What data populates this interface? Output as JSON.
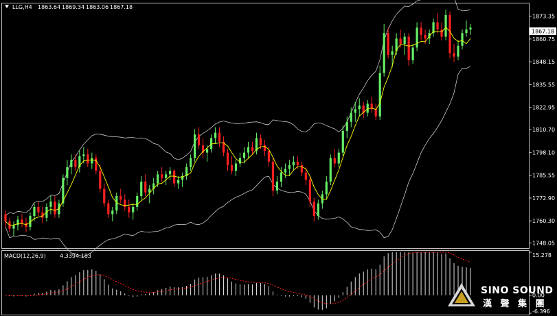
{
  "header": {
    "symbol_label": "LLG,H4",
    "open": "1863.64",
    "high": "1869.34",
    "low": "1863.06",
    "close": "1867.18"
  },
  "price_axis": {
    "ticks": [
      "1873.35",
      "1860.75",
      "1848.15",
      "1835.55",
      "1822.95",
      "1810.70",
      "1798.10",
      "1785.55",
      "1772.90",
      "1760.30",
      "1748.05"
    ],
    "current_price": "1867.18"
  },
  "macd": {
    "label": "MACD(12,26,9)",
    "macd_value": "4.339",
    "signal_value": "4.183",
    "ticks": [
      "15.278",
      "0.00",
      "-6.396"
    ]
  },
  "watermark": {
    "brand_en": "SINO SOUND",
    "brand_cn": "漢 聲 集 團"
  },
  "colors": {
    "background": "#000000",
    "bull": "#66ee66",
    "bear": "#ff2020",
    "ma": "#ffff00",
    "bollinger": "#c8c8c8",
    "macd_hist": "#e0e0e0",
    "macd_signal": "#ff2020",
    "panel_border": "#c0c0c0"
  },
  "chart_data": {
    "type": "candlestick",
    "title": "LLG,H4",
    "ylim": [
      1746,
      1880
    ],
    "ohlc": [
      [
        1764,
        1766,
        1757,
        1760
      ],
      [
        1760,
        1762,
        1754,
        1756
      ],
      [
        1756,
        1760,
        1752,
        1758
      ],
      [
        1758,
        1763,
        1755,
        1761
      ],
      [
        1761,
        1764,
        1757,
        1759
      ],
      [
        1759,
        1762,
        1754,
        1757
      ],
      [
        1757,
        1765,
        1755,
        1763
      ],
      [
        1763,
        1770,
        1760,
        1768
      ],
      [
        1768,
        1771,
        1763,
        1765
      ],
      [
        1765,
        1768,
        1759,
        1762
      ],
      [
        1762,
        1770,
        1760,
        1768
      ],
      [
        1768,
        1774,
        1764,
        1771
      ],
      [
        1771,
        1774,
        1762,
        1764
      ],
      [
        1764,
        1772,
        1762,
        1770
      ],
      [
        1770,
        1786,
        1768,
        1784
      ],
      [
        1784,
        1794,
        1780,
        1790
      ],
      [
        1790,
        1797,
        1786,
        1794
      ],
      [
        1794,
        1797,
        1788,
        1790
      ],
      [
        1790,
        1799,
        1787,
        1796
      ],
      [
        1796,
        1801,
        1792,
        1797
      ],
      [
        1797,
        1800,
        1790,
        1792
      ],
      [
        1792,
        1798,
        1789,
        1795
      ],
      [
        1795,
        1797,
        1786,
        1788
      ],
      [
        1788,
        1791,
        1776,
        1778
      ],
      [
        1778,
        1781,
        1768,
        1770
      ],
      [
        1770,
        1772,
        1762,
        1764
      ],
      [
        1764,
        1768,
        1760,
        1766
      ],
      [
        1766,
        1776,
        1764,
        1774
      ],
      [
        1774,
        1778,
        1770,
        1772
      ],
      [
        1772,
        1775,
        1766,
        1768
      ],
      [
        1768,
        1772,
        1762,
        1765
      ],
      [
        1765,
        1770,
        1761,
        1768
      ],
      [
        1768,
        1776,
        1766,
        1774
      ],
      [
        1774,
        1785,
        1772,
        1782
      ],
      [
        1782,
        1786,
        1774,
        1776
      ],
      [
        1776,
        1780,
        1770,
        1778
      ],
      [
        1778,
        1784,
        1775,
        1781
      ],
      [
        1781,
        1788,
        1779,
        1786
      ],
      [
        1786,
        1790,
        1782,
        1784
      ],
      [
        1784,
        1788,
        1780,
        1786
      ],
      [
        1786,
        1790,
        1783,
        1788
      ],
      [
        1788,
        1789,
        1779,
        1781
      ],
      [
        1781,
        1785,
        1778,
        1783
      ],
      [
        1783,
        1787,
        1779,
        1785
      ],
      [
        1785,
        1792,
        1783,
        1790
      ],
      [
        1790,
        1797,
        1788,
        1795
      ],
      [
        1795,
        1811,
        1793,
        1808
      ],
      [
        1808,
        1812,
        1800,
        1802
      ],
      [
        1802,
        1806,
        1795,
        1798
      ],
      [
        1798,
        1802,
        1793,
        1800
      ],
      [
        1800,
        1808,
        1798,
        1806
      ],
      [
        1806,
        1812,
        1803,
        1809
      ],
      [
        1809,
        1812,
        1801,
        1804
      ],
      [
        1804,
        1807,
        1796,
        1798
      ],
      [
        1798,
        1800,
        1788,
        1791
      ],
      [
        1791,
        1796,
        1786,
        1788
      ],
      [
        1788,
        1794,
        1785,
        1792
      ],
      [
        1792,
        1798,
        1790,
        1795
      ],
      [
        1795,
        1801,
        1792,
        1798
      ],
      [
        1798,
        1804,
        1795,
        1801
      ],
      [
        1801,
        1804,
        1797,
        1799
      ],
      [
        1799,
        1809,
        1797,
        1806
      ],
      [
        1806,
        1808,
        1800,
        1802
      ],
      [
        1802,
        1805,
        1796,
        1799
      ],
      [
        1799,
        1801,
        1790,
        1793
      ],
      [
        1793,
        1795,
        1774,
        1777
      ],
      [
        1777,
        1785,
        1775,
        1782
      ],
      [
        1782,
        1790,
        1779,
        1787
      ],
      [
        1787,
        1792,
        1784,
        1789
      ],
      [
        1789,
        1794,
        1785,
        1791
      ],
      [
        1791,
        1796,
        1788,
        1793
      ],
      [
        1793,
        1796,
        1789,
        1791
      ],
      [
        1791,
        1793,
        1785,
        1787
      ],
      [
        1787,
        1790,
        1780,
        1783
      ],
      [
        1783,
        1785,
        1768,
        1771
      ],
      [
        1771,
        1773,
        1760,
        1763
      ],
      [
        1763,
        1772,
        1761,
        1770
      ],
      [
        1770,
        1777,
        1767,
        1775
      ],
      [
        1775,
        1785,
        1772,
        1782
      ],
      [
        1782,
        1797,
        1780,
        1795
      ],
      [
        1795,
        1800,
        1790,
        1792
      ],
      [
        1792,
        1800,
        1790,
        1798
      ],
      [
        1798,
        1813,
        1796,
        1810
      ],
      [
        1810,
        1818,
        1806,
        1815
      ],
      [
        1815,
        1823,
        1812,
        1820
      ],
      [
        1820,
        1826,
        1815,
        1822
      ],
      [
        1822,
        1828,
        1818,
        1824
      ],
      [
        1824,
        1826,
        1817,
        1820
      ],
      [
        1820,
        1827,
        1818,
        1825
      ],
      [
        1825,
        1829,
        1820,
        1822
      ],
      [
        1822,
        1825,
        1816,
        1818
      ],
      [
        1818,
        1846,
        1816,
        1842
      ],
      [
        1842,
        1869,
        1840,
        1864
      ],
      [
        1864,
        1867,
        1850,
        1852
      ],
      [
        1852,
        1857,
        1845,
        1854
      ],
      [
        1854,
        1864,
        1852,
        1861
      ],
      [
        1861,
        1866,
        1856,
        1858
      ],
      [
        1858,
        1864,
        1852,
        1862
      ],
      [
        1862,
        1864,
        1846,
        1849
      ],
      [
        1849,
        1858,
        1847,
        1856
      ],
      [
        1856,
        1870,
        1854,
        1867
      ],
      [
        1867,
        1870,
        1860,
        1863
      ],
      [
        1863,
        1866,
        1858,
        1861
      ],
      [
        1861,
        1866,
        1858,
        1864
      ],
      [
        1864,
        1872,
        1862,
        1870
      ],
      [
        1870,
        1875,
        1864,
        1866
      ],
      [
        1866,
        1870,
        1860,
        1862
      ],
      [
        1862,
        1877,
        1860,
        1874
      ],
      [
        1874,
        1876,
        1850,
        1853
      ],
      [
        1853,
        1858,
        1848,
        1851
      ],
      [
        1851,
        1860,
        1849,
        1857
      ],
      [
        1857,
        1866,
        1855,
        1864
      ],
      [
        1864,
        1871,
        1862,
        1866
      ],
      [
        1866,
        1869,
        1863,
        1867
      ]
    ]
  }
}
